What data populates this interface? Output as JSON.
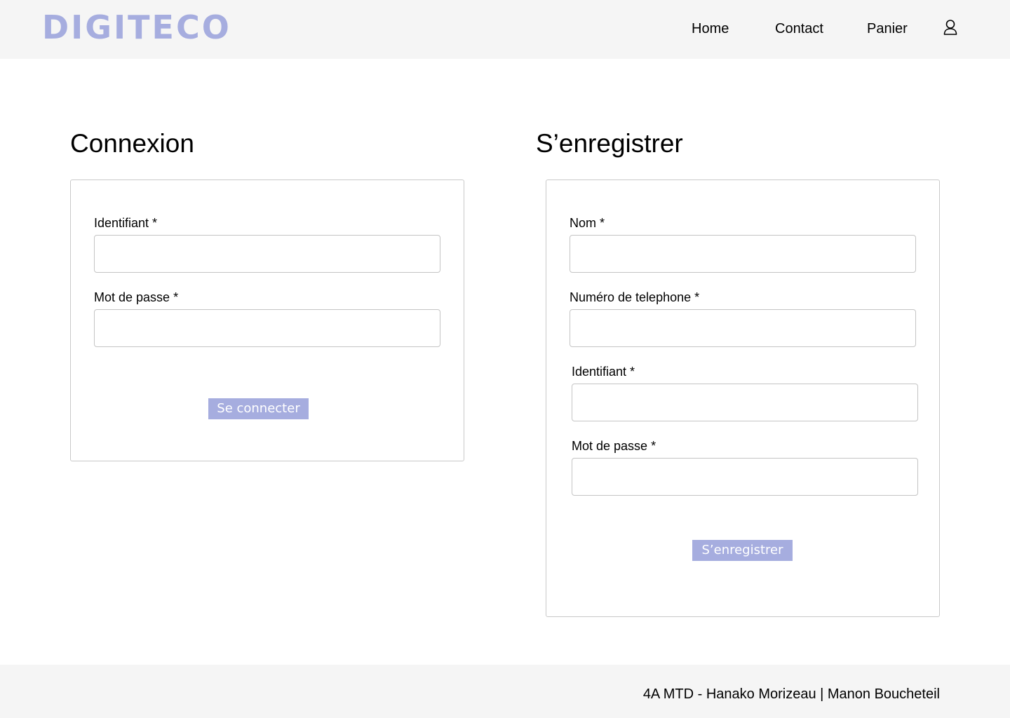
{
  "header": {
    "logo": "DIGITECO",
    "nav": {
      "home": "Home",
      "contact": "Contact",
      "cart": "Panier"
    },
    "icons": {
      "account": "user-icon"
    }
  },
  "login": {
    "title": "Connexion",
    "identifier_label": "Identifiant *",
    "identifier_value": "",
    "password_label": "Mot de passe *",
    "password_value": "",
    "submit_label": "Se connecter"
  },
  "register": {
    "title": "S’enregistrer",
    "name_label": "Nom *",
    "name_value": "",
    "phone_label": "Numéro de telephone *",
    "phone_value": "",
    "identifier_label": "Identifiant *",
    "identifier_value": "",
    "password_label": "Mot de passe *",
    "password_value": "",
    "submit_label": "S’enregistrer"
  },
  "footer": {
    "credits": "4A MTD - Hanako Morizeau | Manon Boucheteil"
  },
  "colors": {
    "accent": "#a6addf",
    "header_bg": "#f5f5f5",
    "footer_bg": "#f5f5f5",
    "border": "#c8c8c8"
  }
}
